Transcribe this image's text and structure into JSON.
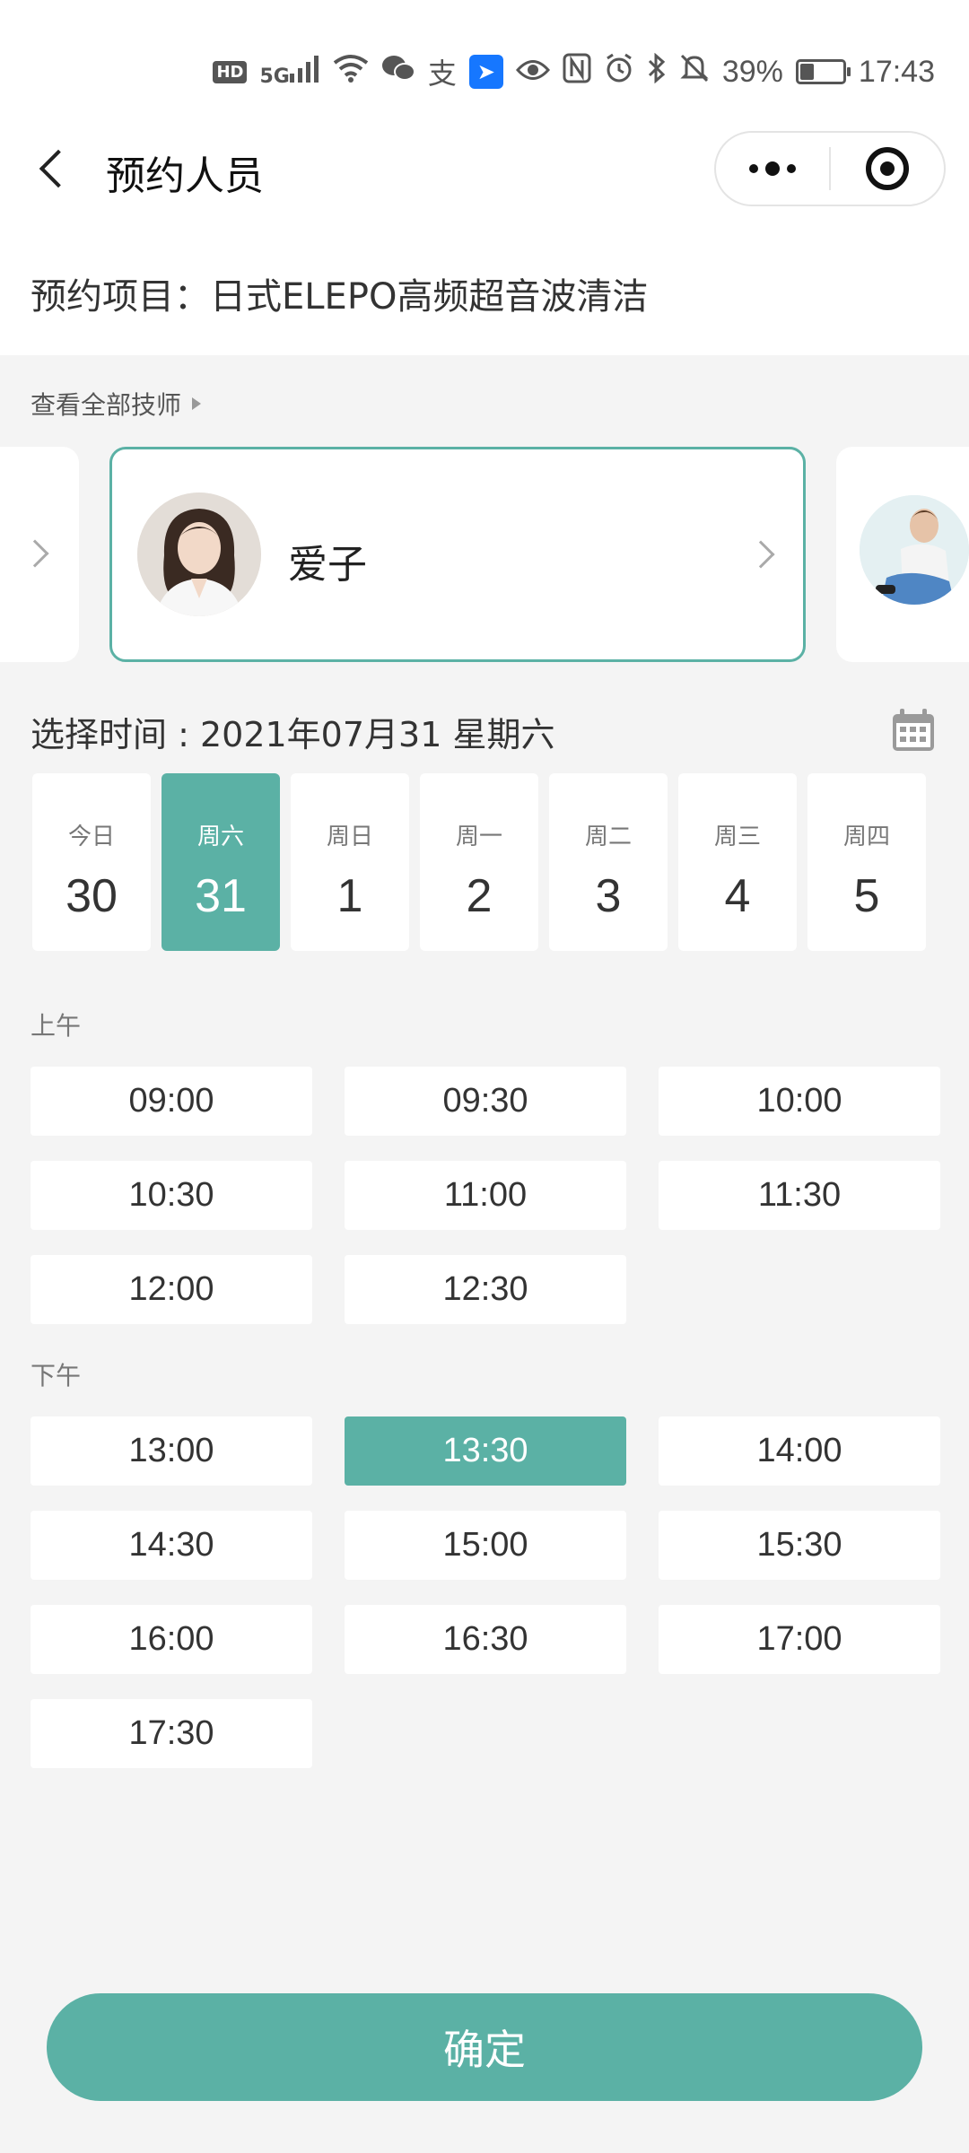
{
  "status_bar": {
    "battery": "39%",
    "time": "17:43",
    "network": "5G",
    "hd": "HD",
    "icons": [
      "hd-icon",
      "signal-icon",
      "wifi-icon",
      "wechat-icon",
      "alipay-icon",
      "dingtalk-icon",
      "eye-icon",
      "nfc-icon",
      "alarm-icon",
      "bluetooth-icon",
      "mute-icon",
      "battery-icon"
    ]
  },
  "nav": {
    "title": "预约人员"
  },
  "project": {
    "text": "预约项目：日式ELEPO高频超音波清洁"
  },
  "technicians": {
    "view_all": "查看全部技师",
    "selected_name": "爱子"
  },
  "date": {
    "label": "选择时间 : 2021年07月31 星期六",
    "days": [
      {
        "weekday": "今日",
        "day": "30"
      },
      {
        "weekday": "周六",
        "day": "31"
      },
      {
        "weekday": "周日",
        "day": "1"
      },
      {
        "weekday": "周一",
        "day": "2"
      },
      {
        "weekday": "周二",
        "day": "3"
      },
      {
        "weekday": "周三",
        "day": "4"
      },
      {
        "weekday": "周四",
        "day": "5"
      }
    ],
    "selected_index": 1
  },
  "morning": {
    "label": "上午",
    "slots": [
      "09:00",
      "09:30",
      "10:00",
      "10:30",
      "11:00",
      "11:30",
      "12:00",
      "12:30"
    ]
  },
  "afternoon": {
    "label": "下午",
    "slots": [
      "13:00",
      "13:30",
      "14:00",
      "14:30",
      "15:00",
      "15:30",
      "16:00",
      "16:30",
      "17:00",
      "17:30"
    ],
    "selected": "13:30"
  },
  "confirm_label": "确定",
  "colors": {
    "accent": "#5bb1a5",
    "background": "#f4f4f4"
  }
}
